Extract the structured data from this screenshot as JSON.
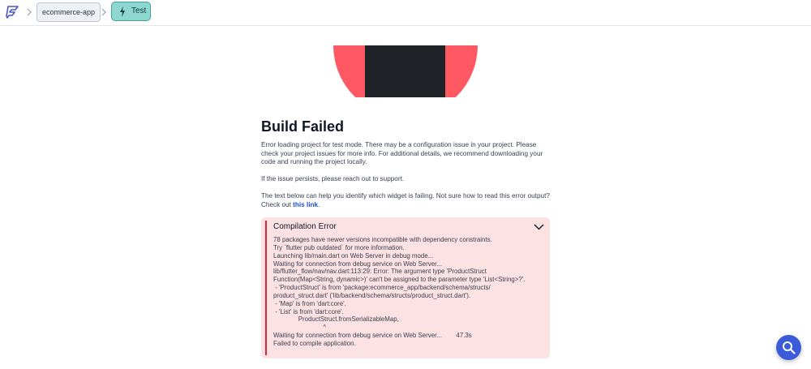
{
  "breadcrumb": {
    "project": "ecommerce-app",
    "mode": "Test"
  },
  "icons": {
    "logo": "flutterflow-logo-icon",
    "separator": "chevron-right-icon",
    "mode": "lightning-bolt-icon",
    "collapse": "chevron-down-icon",
    "fab": "search-icon"
  },
  "colors": {
    "accent_teal": "#8fd6d0",
    "error_bg": "#fde2e3",
    "error_bar": "#d7263d",
    "link": "#1d4ed8",
    "fab": "#3b5bdb"
  },
  "content": {
    "title": "Build Failed",
    "paragraph1": "Error loading project for test mode. There may be a configuration issue in your project. Please check your project issues for more info. For additional details, we recommend downloading your code and running the project locally.",
    "paragraph2": "If the issue persists, please reach out to support.",
    "paragraph3_text": "The text below can help you identify which widget is failing. Not sure how to read this error output? Check out ",
    "paragraph3_link": "this link",
    "paragraph3_end": "."
  },
  "error": {
    "title": "Compilation Error",
    "log": "78 packages have newer versions incompatible with dependency constraints.\nTry `flutter pub outdated` for more information.\nLaunching lib/main.dart on Web Server in debug mode...\nWaiting for connection from debug service on Web Server...\nlib/flutter_flow/nav/nav.dart:113:29: Error: The argument type 'ProductStruct\nFunction(Map<String, dynamic>)' can't be assigned to the parameter type 'List<String>?'.\n - 'ProductStruct' is from 'package:ecommerce_app/backend/schema/structs/\nproduct_struct.dart' ('lib/backend/schema/structs/product_struct.dart').\n - 'Map' is from 'dart:core'.\n - 'List' is from 'dart:core'.\n              ProductStruct.fromSerializableMap,\n                            ^\nWaiting for connection from debug service on Web Server...        47.3s\nFailed to compile application."
  }
}
